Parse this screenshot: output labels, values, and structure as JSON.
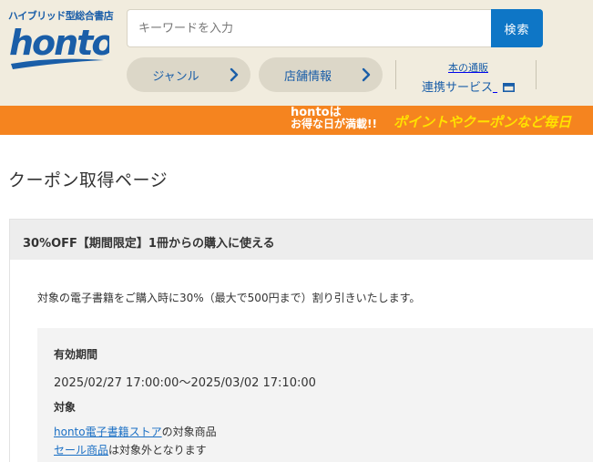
{
  "header": {
    "tagline": "ハイブリッド型総合書店",
    "logo_text": "honto",
    "search": {
      "placeholder": "キーワードを入力",
      "value": ""
    },
    "search_button_label": "検索",
    "nav": [
      {
        "label": "ジャンル"
      },
      {
        "label": "店舗情報"
      }
    ],
    "service_small": "本の通販",
    "service_big": "連携サービス"
  },
  "banner": {
    "line1": "hontoは",
    "line2": "お得な日が満載!!",
    "tagline": "ポイントやクーポンなど毎日"
  },
  "page": {
    "title": "クーポン取得ページ"
  },
  "coupon": {
    "title": "30%OFF【期間限定】1冊からの購入に使える",
    "description": "対象の電子書籍をご購入時に30%（最大で500円まで）割り引きいたします。",
    "period_label": "有効期間",
    "period": "2025/02/27 17:00:00～2025/03/02 17:10:00",
    "target_label": "対象",
    "target1_link": "honto電子書籍ストア",
    "target1_suffix": "の対象商品",
    "target2_link": "セール商品",
    "target2_suffix": "は対象外となります"
  },
  "colors": {
    "header_bg": "#f1ecde",
    "brand_blue": "#1a5ea8",
    "search_button": "#0e76c6",
    "banner_orange": "#f5841f",
    "banner_yellow": "#ffe100"
  },
  "icons": [
    "chevron-right-icon",
    "window-icon"
  ]
}
